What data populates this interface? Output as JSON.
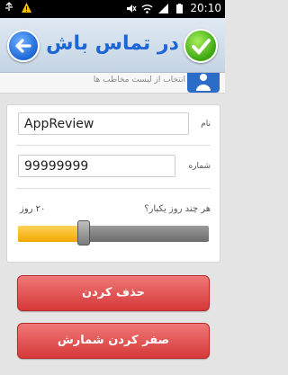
{
  "status_bar": {
    "time": "20:10",
    "icons": [
      "usb-icon",
      "warning-icon",
      "mute-icon",
      "wifi-icon",
      "signal-icon",
      "battery-icon"
    ]
  },
  "header": {
    "title": "در تماس باش",
    "back_icon": "back-arrow-icon",
    "confirm_icon": "checkmark-icon"
  },
  "contact_strip": {
    "text": "انتخاب از لیست مخاطب ها"
  },
  "form": {
    "name_label": "نام",
    "name_value": "AppReview",
    "number_label": "شماره",
    "number_value": "99999999",
    "interval_label": "هر چند روز یکبار؟",
    "interval_value": "۲۰ روز",
    "interval_fraction": 0.34
  },
  "buttons": {
    "delete_label": "حذف کردن",
    "reset_label": "صفر کردن شمارش"
  },
  "colors": {
    "accent_blue": "#1d66d6",
    "accent_green": "#3aa511",
    "button_red": "#d63838",
    "slider_yellow": "#f2a600"
  }
}
